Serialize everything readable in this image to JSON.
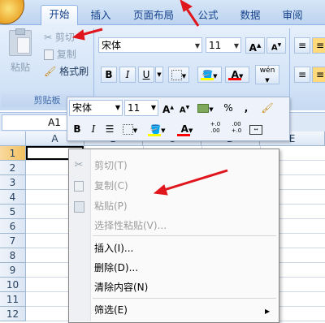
{
  "tabs": [
    {
      "label": "开始",
      "active": true
    },
    {
      "label": "插入"
    },
    {
      "label": "页面布局"
    },
    {
      "label": "公式"
    },
    {
      "label": "数据"
    },
    {
      "label": "审阅"
    }
  ],
  "clipboard": {
    "paste_label": "粘贴",
    "cut_label": "剪切",
    "copy_label": "复制",
    "format_painter_label": "格式刷",
    "group_label": "剪贴板"
  },
  "font": {
    "name": "宋体",
    "size": "11",
    "bold": "B",
    "italic": "I",
    "underline": "U",
    "grow": "A",
    "shrink": "A",
    "font_color_letter": "A",
    "phonetic": "wén"
  },
  "name_box": "A1",
  "columns": [
    "A",
    "B",
    "C",
    "D",
    "E"
  ],
  "rows": [
    "1",
    "2",
    "3",
    "4",
    "5",
    "6",
    "7",
    "8",
    "9",
    "10",
    "11",
    "12"
  ],
  "mini_toolbar": {
    "font_name": "宋体",
    "font_size": "11",
    "percent": "%",
    "comma": ",",
    "bold": "B",
    "italic": "I",
    "font_color_letter": "A",
    "inc_decimal": "+.0\n.00",
    "dec_decimal": ".00\n+.0"
  },
  "context_menu": [
    {
      "label": "剪切(T)",
      "disabled": true
    },
    {
      "label": "复制(C)",
      "disabled": true
    },
    {
      "label": "粘贴(P)",
      "disabled": true
    },
    {
      "label": "选择性粘贴(V)...",
      "disabled": true
    },
    {
      "label": "插入(I)..."
    },
    {
      "label": "删除(D)..."
    },
    {
      "label": "清除内容(N)"
    },
    {
      "label": "筛选(E)"
    }
  ],
  "colors": {
    "accent": "#15428b",
    "arrow_red": "#e0161d",
    "highlight_yellow": "#ffff00",
    "font_red": "#ff0000"
  }
}
